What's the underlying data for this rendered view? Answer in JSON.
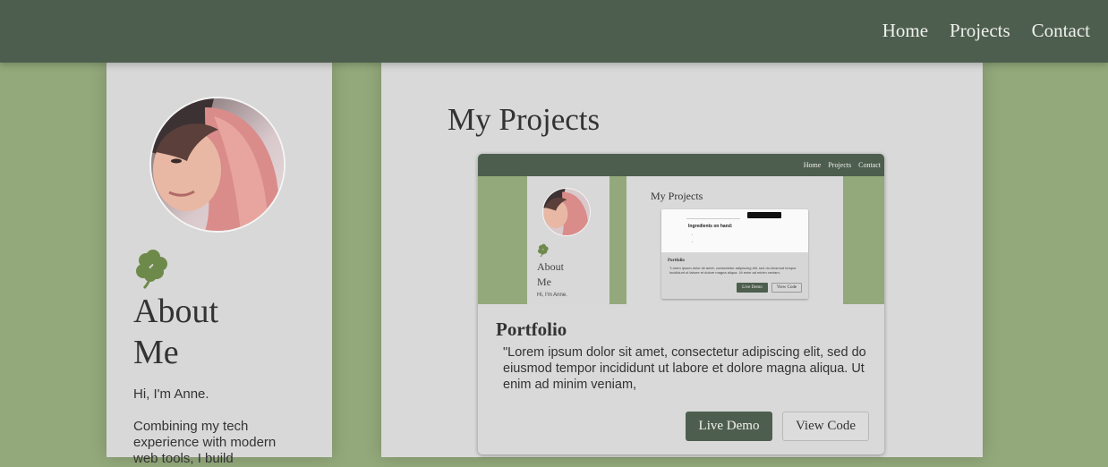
{
  "nav": {
    "items": [
      "Home",
      "Projects",
      "Contact"
    ]
  },
  "sidebar": {
    "clover_icon": "four-leaf-clover-icon",
    "heading_line1": "About",
    "heading_line2": "Me",
    "greeting": "Hi, I'm Anne.",
    "bio": "Combining my tech experience with modern web tools, I build"
  },
  "main": {
    "title": "My Projects",
    "projects": [
      {
        "title": "Portfolio",
        "description": "\"Lorem ipsum dolor sit amet, consectetur adipiscing elit, sed do eiusmod tempor incididunt ut labore et dolore magna aliqua. Ut enim ad minim veniam,",
        "live_demo_label": "Live Demo",
        "view_code_label": "View Code",
        "preview": {
          "nav": [
            "Home",
            "Projects",
            "Contact"
          ],
          "about_line1": "About",
          "about_line2": "Me",
          "greeting": "Hi, I'm Anne.",
          "title": "My Projects",
          "ingredients_heading": "Ingredients on hand:",
          "card_title": "Portfolio",
          "card_text": "\"Lorem ipsum dolor sit amet, consectetur adipiscing elit, sed do eiusmod tempor incididunt ut labore et dolore magna aliqua. Ut enim ad minim veniam,",
          "live_demo_label": "Live Demo",
          "view_code_label": "View Code"
        }
      }
    ]
  },
  "colors": {
    "navbar": "#4d5e4e",
    "page_background": "#93a97b",
    "card_background": "#d9d9d9",
    "clover": "#6e8a4a"
  }
}
